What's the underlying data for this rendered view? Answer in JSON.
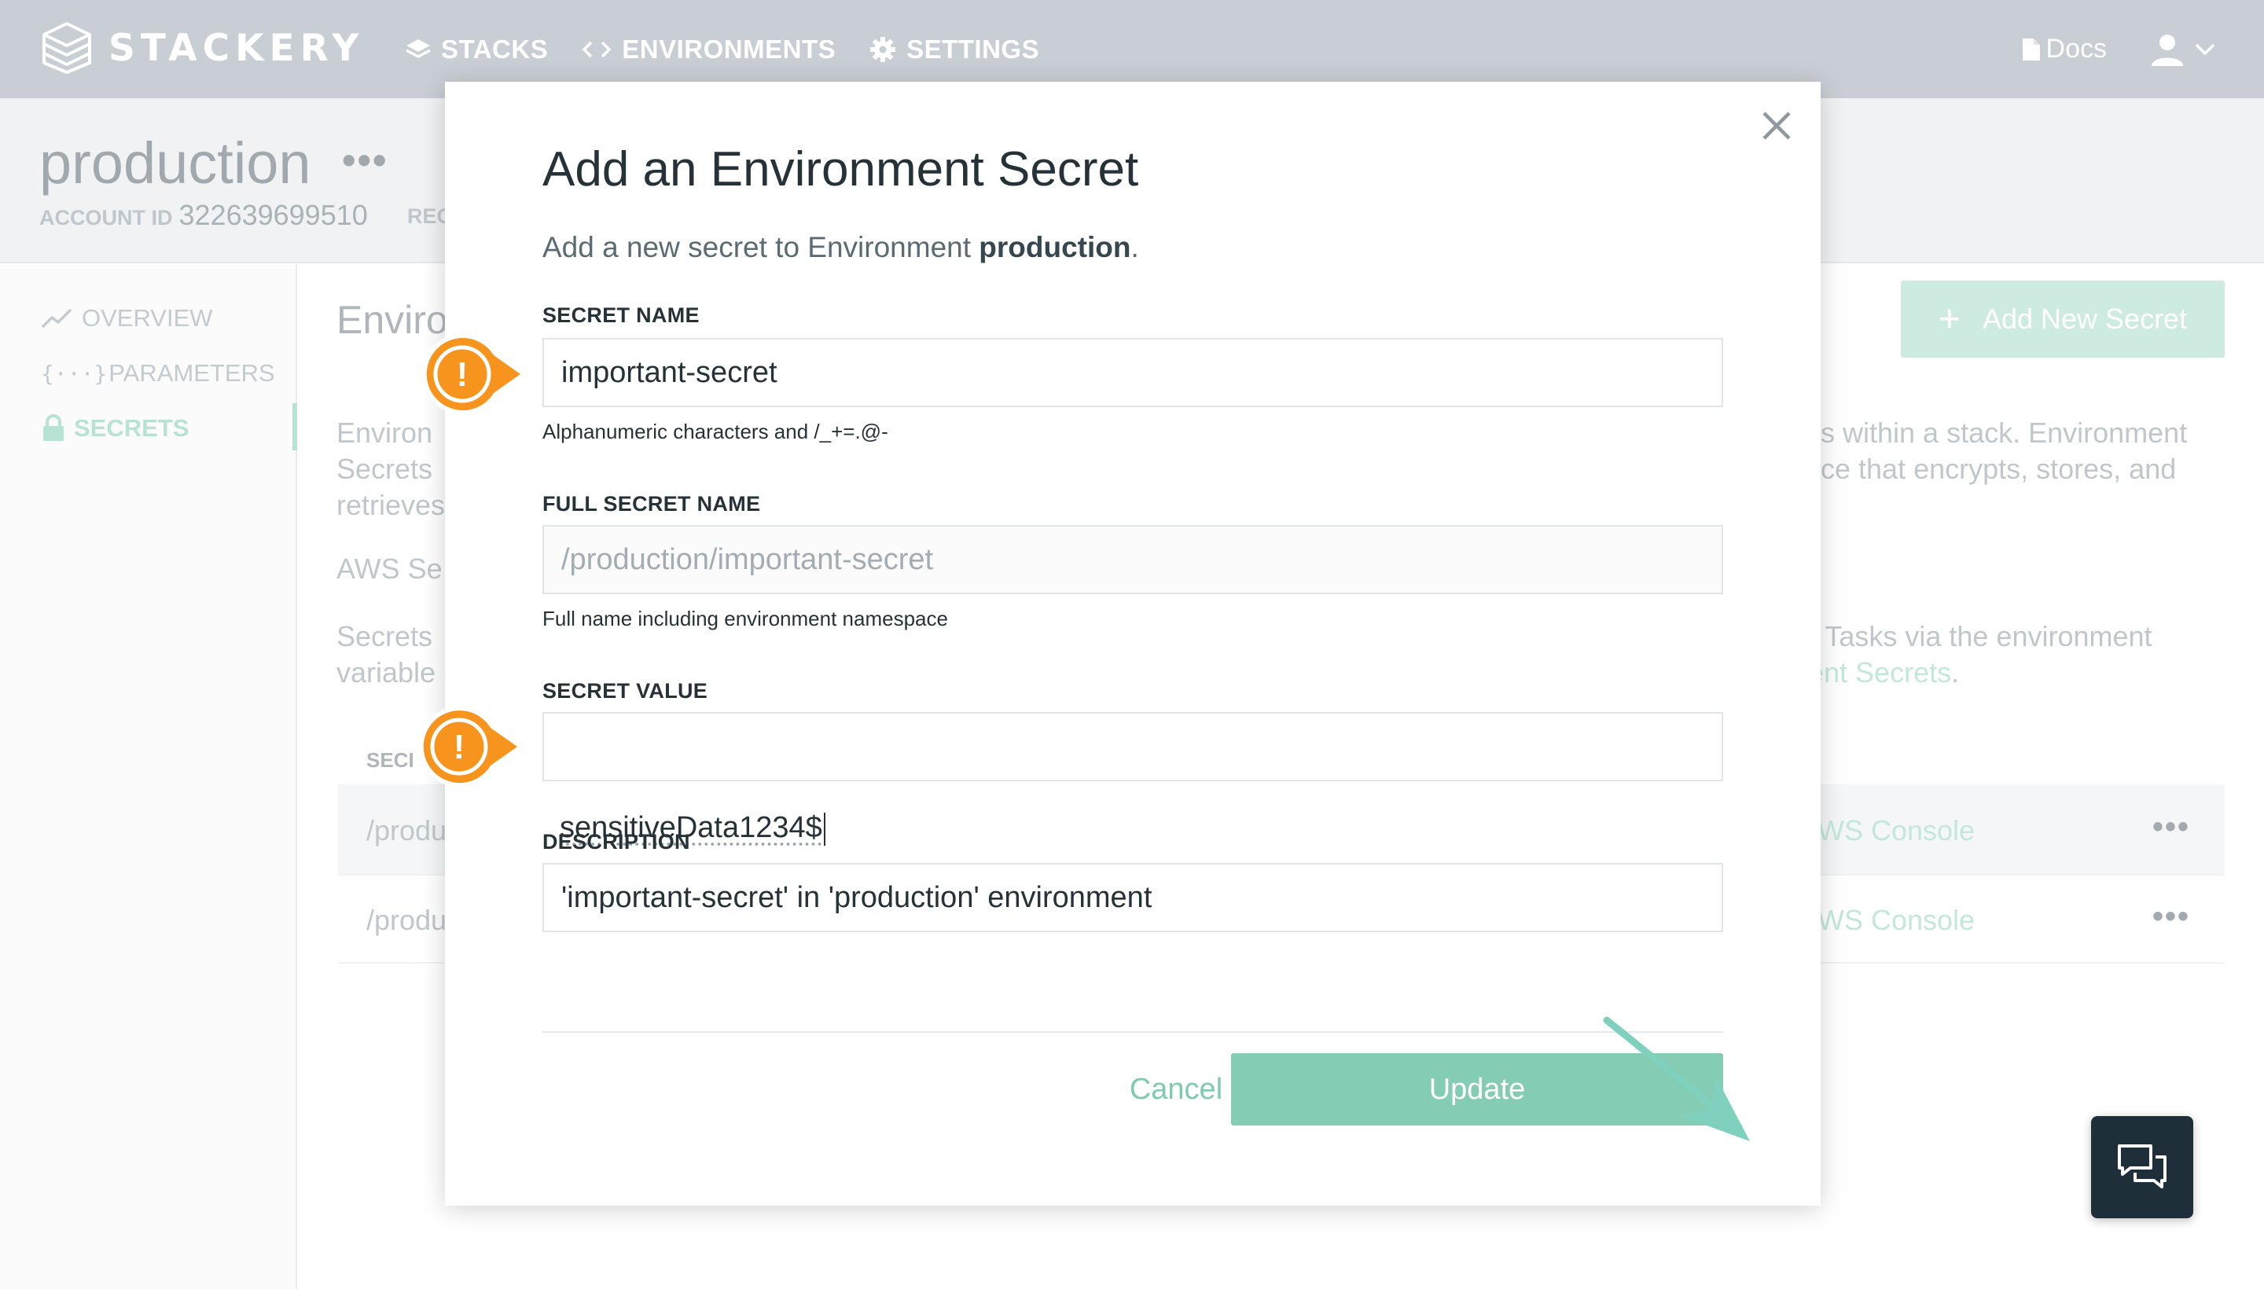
{
  "brand": {
    "name": "STACKERY"
  },
  "nav": {
    "items": [
      {
        "label": "STACKS",
        "icon": "layers-icon"
      },
      {
        "label": "ENVIRONMENTS",
        "icon": "code-brackets-icon"
      },
      {
        "label": "SETTINGS",
        "icon": "gear-icon"
      }
    ],
    "docs": "Docs"
  },
  "header": {
    "title": "production",
    "account_label": "ACCOUNT ID",
    "account_id": "322639699510",
    "region_fragment": "REG"
  },
  "sidebar": {
    "items": [
      {
        "label": "OVERVIEW",
        "icon": "trend-line-icon",
        "active": false
      },
      {
        "label": "PARAMETERS",
        "icon": "braces-icon",
        "active": false
      },
      {
        "label": "SECRETS",
        "icon": "lock-icon",
        "active": true
      }
    ]
  },
  "background": {
    "section_title_fragment": "Enviro",
    "add_button": "Add New Secret",
    "para1_left": [
      "Environ",
      "Secrets",
      "retrieves"
    ],
    "para1_right": [
      "s within a stack. Environment",
      "ce that encrypts, stores, and"
    ],
    "para2_left": "AWS Se",
    "para3_left": [
      "Secrets",
      "variable"
    ],
    "para3_right_line1": "r Tasks via the environment",
    "para3_right_link": "ent Secrets",
    "para3_right_end": ".",
    "table_header_fragment": "SECI",
    "rows": [
      {
        "name_fragment": "/produ",
        "console_fragment": "WS Console"
      },
      {
        "name_fragment": "/produ",
        "console_fragment": "WS Console"
      }
    ]
  },
  "modal": {
    "title": "Add an Environment Secret",
    "subtitle_prefix": "Add a new secret to Environment ",
    "subtitle_env": "production",
    "subtitle_suffix": ".",
    "fields": {
      "secret_name": {
        "label": "SECRET NAME",
        "value": "important-secret",
        "hint": "Alphanumeric characters and /_+=.@-"
      },
      "full_secret_name": {
        "label": "FULL SECRET NAME",
        "placeholder": "/production/important-secret",
        "hint": "Full name including environment namespace"
      },
      "secret_value": {
        "label": "SECRET VALUE",
        "value": "sensitiveData1234$"
      },
      "description": {
        "label": "DESCRIPTION",
        "value": "'important-secret' in 'production' environment"
      }
    },
    "cancel": "Cancel",
    "submit": "Update"
  },
  "annotations": {
    "marker_glyph": "!",
    "marker_color": "#f7941d",
    "arrow_color": "#7fd1bd"
  },
  "colors": {
    "accent": "#85ccb5",
    "topnav": "#bcc4ca",
    "chat": "#1e2f3a"
  }
}
